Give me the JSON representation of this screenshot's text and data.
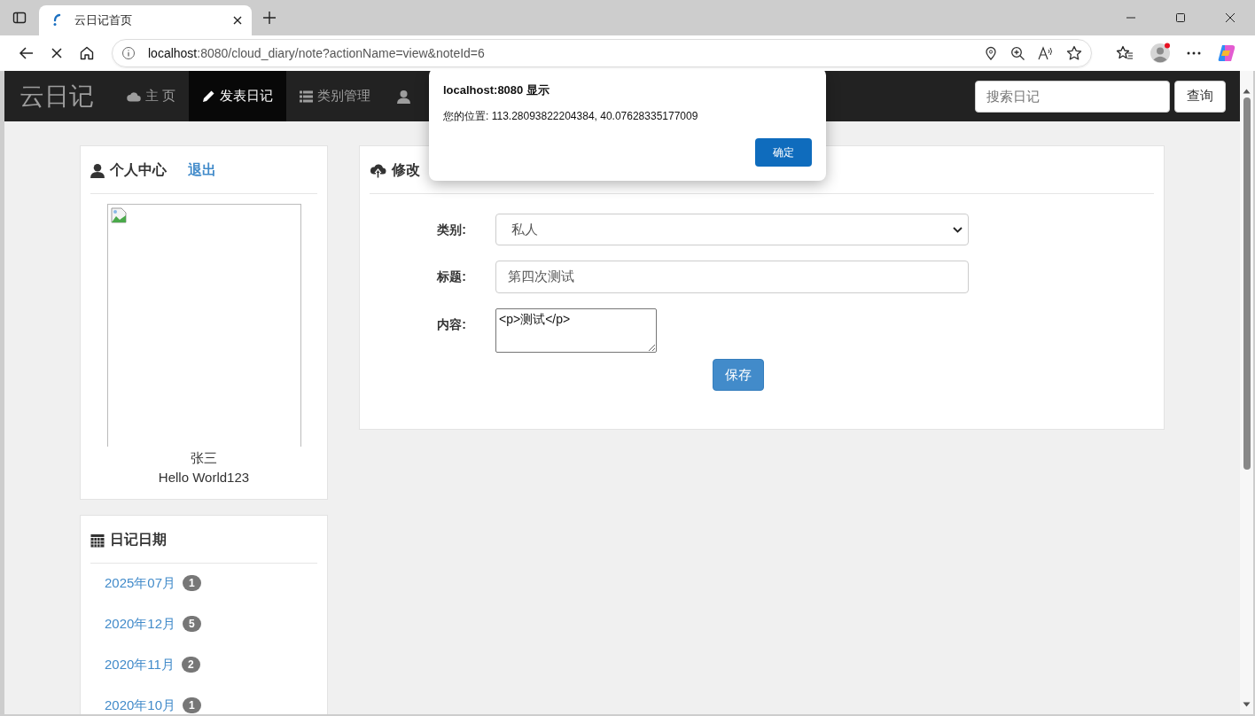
{
  "browser": {
    "tab_title": "云日记首页",
    "url_host": "localhost",
    "url_rest": ":8080/cloud_diary/note?actionName=view&noteId=6"
  },
  "navbar": {
    "brand": "云日记",
    "items": [
      {
        "label": "主 页",
        "selected": false
      },
      {
        "label": "发表日记",
        "selected": true
      },
      {
        "label": "类别管理",
        "selected": false
      },
      {
        "selected": false
      }
    ],
    "search": {
      "placeholder": "搜索日记"
    },
    "search_button": "查询"
  },
  "dialog": {
    "title": "localhost:8080 显示",
    "message": "您的位置: 113.28093822204384, 40.07628335177009",
    "button": "确定"
  },
  "profile": {
    "title": "个人中心",
    "logout": "退出",
    "name": "张三",
    "mood": "Hello World123"
  },
  "dates": {
    "title": "日记日期",
    "items": [
      {
        "label": "2025年07月",
        "count": "1"
      },
      {
        "label": "2020年12月",
        "count": "5"
      },
      {
        "label": "2020年11月",
        "count": "2"
      },
      {
        "label": "2020年10月",
        "count": "1"
      }
    ]
  },
  "editor": {
    "title": "修改",
    "fields": [
      {
        "kind": "select",
        "label": "类别:",
        "value": "私人"
      },
      {
        "kind": "input",
        "label": "标题:",
        "value": "第四次测试"
      },
      {
        "kind": "textarea",
        "label": "内容:",
        "value": "<p>测试</p>"
      }
    ],
    "save_button": "保存"
  }
}
